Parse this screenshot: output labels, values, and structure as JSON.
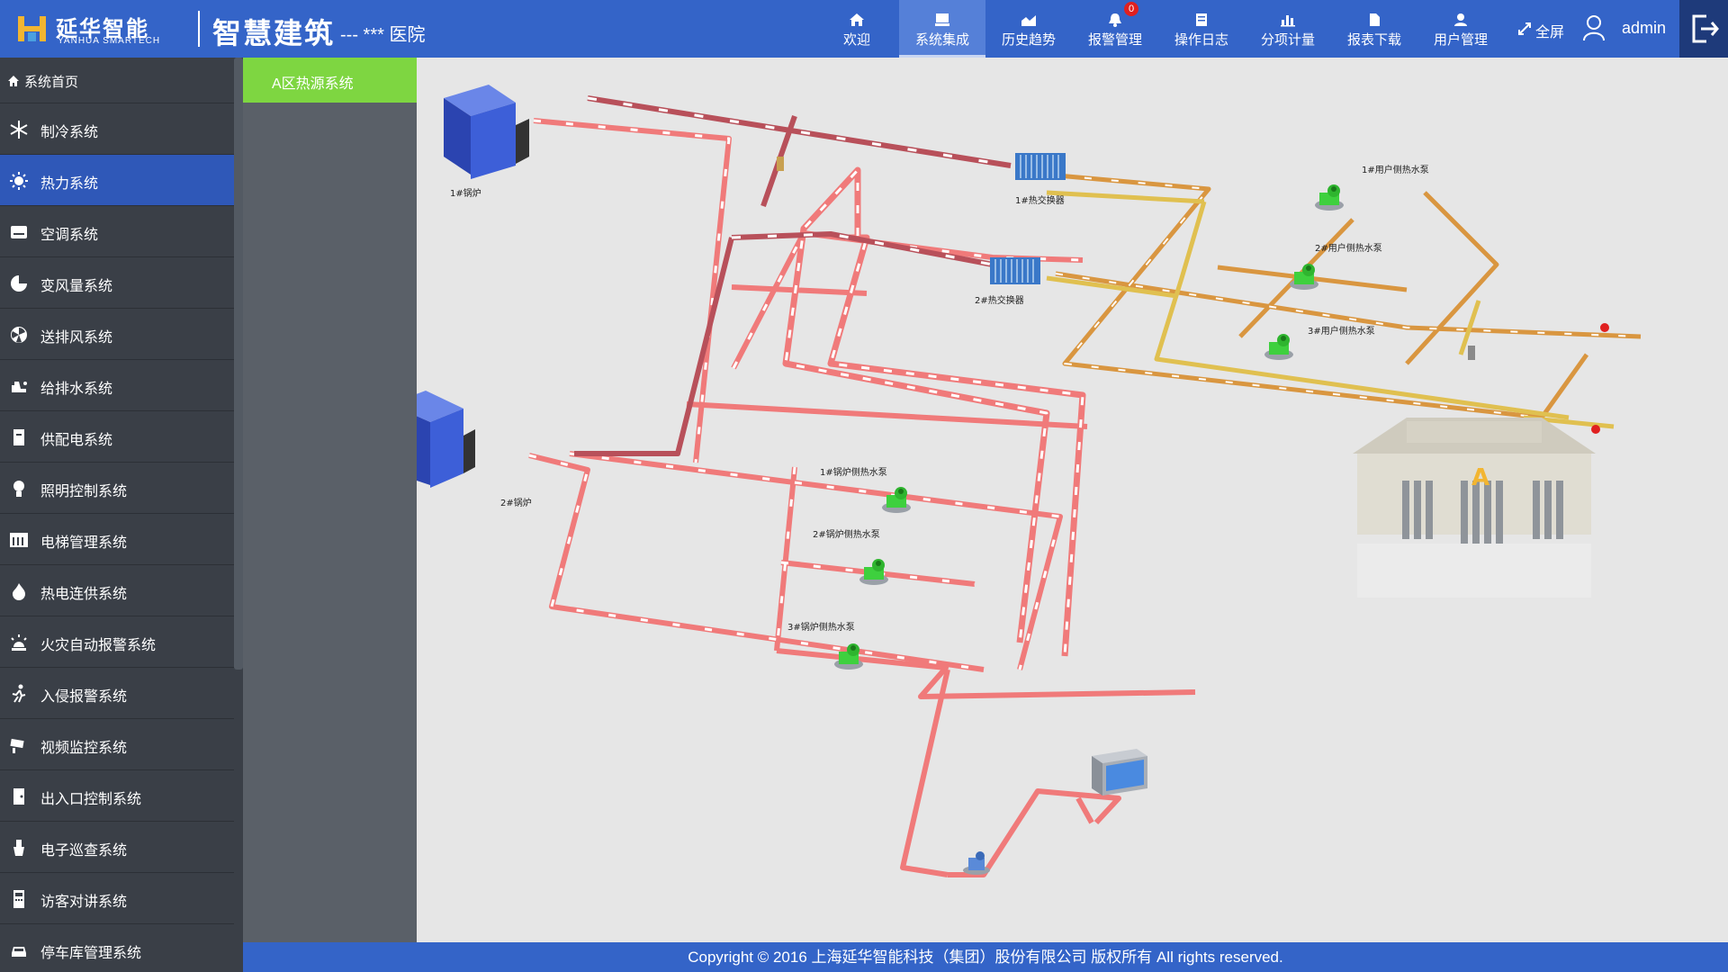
{
  "header": {
    "brand_cn": "延华智能",
    "brand_en": "YANHUA SMARTECH",
    "app_title": "智慧建筑",
    "app_sub": "--- *** 医院",
    "nav": [
      {
        "label": "欢迎",
        "icon": "home-icon"
      },
      {
        "label": "系统集成",
        "icon": "monitor-icon"
      },
      {
        "label": "历史趋势",
        "icon": "area-chart-icon"
      },
      {
        "label": "报警管理",
        "icon": "bell-icon",
        "badge": "0"
      },
      {
        "label": "操作日志",
        "icon": "log-icon"
      },
      {
        "label": "分项计量",
        "icon": "bar-chart-icon"
      },
      {
        "label": "报表下载",
        "icon": "document-icon"
      },
      {
        "label": "用户管理",
        "icon": "user-icon"
      }
    ],
    "active_nav": "系统集成",
    "fullscreen_label": "全屏",
    "username": "admin"
  },
  "sidebar": {
    "home": "系统首页",
    "items": [
      {
        "label": "制冷系统",
        "icon": "snowflake-icon"
      },
      {
        "label": "热力系统",
        "icon": "sun-icon"
      },
      {
        "label": "空调系统",
        "icon": "air-conditioner-icon"
      },
      {
        "label": "变风量系统",
        "icon": "airflow-icon"
      },
      {
        "label": "送排风系统",
        "icon": "fan-icon"
      },
      {
        "label": "给排水系统",
        "icon": "water-icon"
      },
      {
        "label": "供配电系统",
        "icon": "power-icon"
      },
      {
        "label": "照明控制系统",
        "icon": "bulb-icon"
      },
      {
        "label": "电梯管理系统",
        "icon": "elevator-icon"
      },
      {
        "label": "热电连供系统",
        "icon": "flame-icon"
      },
      {
        "label": "火灾自动报警系统",
        "icon": "alarm-icon"
      },
      {
        "label": "入侵报警系统",
        "icon": "running-man-icon"
      },
      {
        "label": "视频监控系统",
        "icon": "camera-icon"
      },
      {
        "label": "出入口控制系统",
        "icon": "door-icon"
      },
      {
        "label": "电子巡查系统",
        "icon": "patrol-icon"
      },
      {
        "label": "访客对讲系统",
        "icon": "intercom-icon"
      },
      {
        "label": "停车库管理系统",
        "icon": "car-icon"
      }
    ],
    "active": "热力系统"
  },
  "subnav": {
    "tab": "A区热源系统"
  },
  "diagram": {
    "boiler1": "1#锅炉",
    "boiler2": "2#锅炉",
    "hx1": "1#热交换器",
    "hx2": "2#热交换器",
    "user_pump1": "1#用户侧热水泵",
    "user_pump2": "2#用户侧热水泵",
    "user_pump3": "3#用户侧热水泵",
    "boiler_pump1": "1#锅炉侧热水泵",
    "boiler_pump2": "2#锅炉侧热水泵",
    "boiler_pump3": "3#锅炉侧热水泵",
    "building_mark": "A",
    "colors": {
      "pipe_red": "#f07a7a",
      "pipe_darkred": "#b8505a",
      "pipe_orange": "#d99640",
      "pipe_yellow": "#e0c050",
      "boiler": "#3d5fd8",
      "pump": "#3ed03e"
    }
  },
  "footer": {
    "copyright": "Copyright © 2016 上海延华智能科技（集团）股份有限公司    版权所有 All rights reserved."
  }
}
